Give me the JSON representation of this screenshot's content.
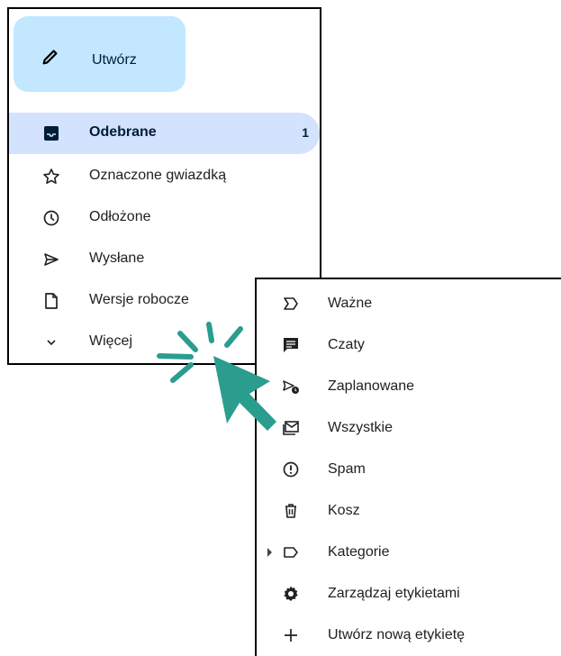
{
  "sidebar": {
    "compose_label": "Utwórz",
    "items": [
      {
        "label": "Odebrane",
        "count": "1",
        "icon": "inbox-icon"
      },
      {
        "label": "Oznaczone gwiazdką",
        "icon": "star-icon"
      },
      {
        "label": "Odłożone",
        "icon": "clock-icon"
      },
      {
        "label": "Wysłane",
        "icon": "send-icon"
      },
      {
        "label": "Wersje robocze",
        "icon": "draft-icon"
      },
      {
        "label": "Więcej",
        "icon": "chevron-down-icon"
      }
    ]
  },
  "more_menu": {
    "items": [
      {
        "label": "Ważne",
        "icon": "important-icon"
      },
      {
        "label": "Czaty",
        "icon": "chat-icon"
      },
      {
        "label": "Zaplanowane",
        "icon": "scheduled-send-icon"
      },
      {
        "label": "Wszystkie",
        "icon": "all-mail-icon"
      },
      {
        "label": "Spam",
        "icon": "spam-icon"
      },
      {
        "label": "Kosz",
        "icon": "trash-icon"
      },
      {
        "label": "Kategorie",
        "icon": "label-icon"
      },
      {
        "label": "Zarządzaj etykietami",
        "icon": "settings-icon"
      },
      {
        "label": "Utwórz nową etykietę",
        "icon": "plus-icon"
      }
    ]
  },
  "colors": {
    "compose_bg": "#c2e7ff",
    "active_bg": "#d3e3fd",
    "cursor": "#2a9d8f"
  }
}
